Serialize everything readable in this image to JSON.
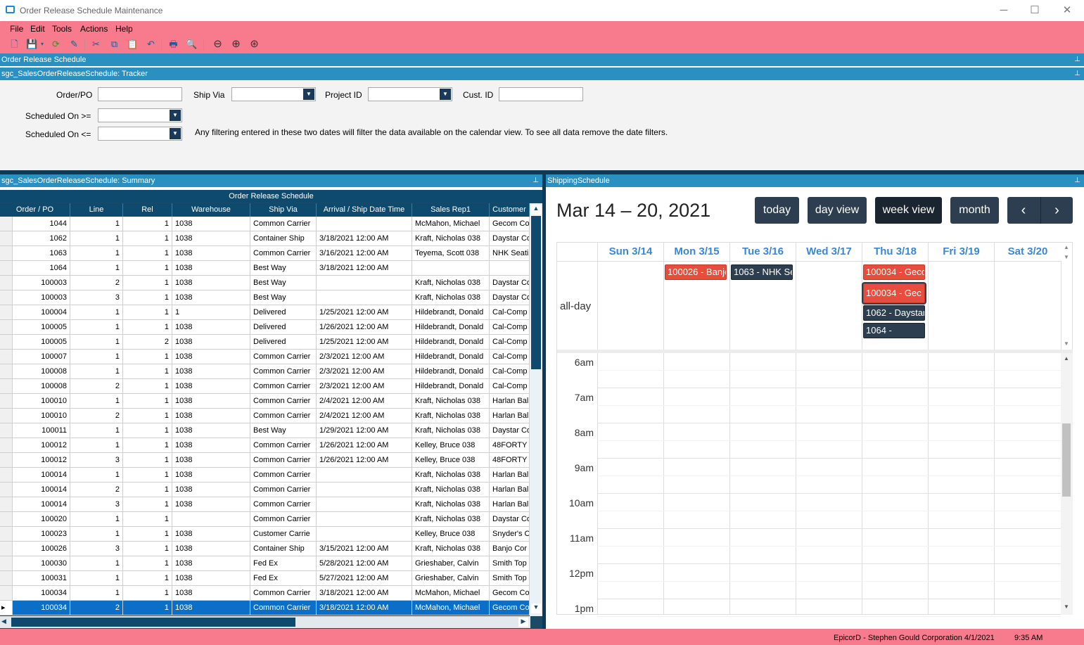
{
  "window": {
    "title": "Order Release Schedule Maintenance"
  },
  "menu": {
    "file": "File",
    "edit": "Edit",
    "tools": "Tools",
    "actions": "Actions",
    "help": "Help"
  },
  "panels": {
    "order_release": "Order Release Schedule",
    "tracker": "sgc_SalesOrderReleaseSchedule: Tracker",
    "summary": "sgc_SalesOrderReleaseSchedule: Summary",
    "shipping": "ShippingSchedule"
  },
  "tracker": {
    "order_po": "Order/PO",
    "ship_via": "Ship Via",
    "project_id": "Project ID",
    "cust_id": "Cust. ID",
    "sched_ge": "Scheduled On >=",
    "sched_le": "Scheduled On <=",
    "note": "Any filtering entered in these two dates will filter the data available on the calendar view. To see all data remove the date filters."
  },
  "grid": {
    "caption": "Order Release Schedule",
    "columns": [
      "Order / PO",
      "Line",
      "Rel",
      "Warehouse",
      "Ship Via",
      "Arrival / Ship Date Time",
      "Sales Rep1",
      "Customer"
    ],
    "rows": [
      [
        "1044",
        "1",
        "1",
        "1038",
        "Common Carrier",
        "",
        "McMahon, Michael",
        "Gecom Co"
      ],
      [
        "1062",
        "1",
        "1",
        "1038",
        "Container Ship",
        "3/18/2021 12:00 AM",
        "Kraft, Nicholas 038",
        "Daystar Co"
      ],
      [
        "1063",
        "1",
        "1",
        "1038",
        "Common Carrier",
        "3/16/2021 12:00 AM",
        "Teyema, Scott 038",
        "NHK Seati"
      ],
      [
        "1064",
        "1",
        "1",
        "1038",
        "Best Way",
        "3/18/2021 12:00 AM",
        "",
        ""
      ],
      [
        "100003",
        "2",
        "1",
        "1038",
        "Best Way",
        "",
        "Kraft, Nicholas 038",
        "Daystar Co"
      ],
      [
        "100003",
        "3",
        "1",
        "1038",
        "Best Way",
        "",
        "Kraft, Nicholas 038",
        "Daystar Co"
      ],
      [
        "100004",
        "1",
        "1",
        "1",
        "Delivered",
        "1/25/2021 12:00 AM",
        "Hildebrandt, Donald",
        "Cal-Comp"
      ],
      [
        "100005",
        "1",
        "1",
        "1038",
        "Delivered",
        "1/26/2021 12:00 AM",
        "Hildebrandt, Donald",
        "Cal-Comp"
      ],
      [
        "100005",
        "1",
        "2",
        "1038",
        "Delivered",
        "1/25/2021 12:00 AM",
        "Hildebrandt, Donald",
        "Cal-Comp"
      ],
      [
        "100007",
        "1",
        "1",
        "1038",
        "Common Carrier",
        "2/3/2021 12:00 AM",
        "Hildebrandt, Donald",
        "Cal-Comp"
      ],
      [
        "100008",
        "1",
        "1",
        "1038",
        "Common Carrier",
        "2/3/2021 12:00 AM",
        "Hildebrandt, Donald",
        "Cal-Comp"
      ],
      [
        "100008",
        "2",
        "1",
        "1038",
        "Common Carrier",
        "2/3/2021 12:00 AM",
        "Hildebrandt, Donald",
        "Cal-Comp"
      ],
      [
        "100010",
        "1",
        "1",
        "1038",
        "Common Carrier",
        "2/4/2021 12:00 AM",
        "Kraft, Nicholas 038",
        "Harlan Bal"
      ],
      [
        "100010",
        "2",
        "1",
        "1038",
        "Common Carrier",
        "2/4/2021 12:00 AM",
        "Kraft, Nicholas 038",
        "Harlan Bal"
      ],
      [
        "100011",
        "1",
        "1",
        "1038",
        "Best Way",
        "1/29/2021 12:00 AM",
        "Kraft, Nicholas 038",
        "Daystar Co"
      ],
      [
        "100012",
        "1",
        "1",
        "1038",
        "Common Carrier",
        "1/26/2021 12:00 AM",
        "Kelley, Bruce 038",
        "48FORTY"
      ],
      [
        "100012",
        "3",
        "1",
        "1038",
        "Common Carrier",
        "1/26/2021 12:00 AM",
        "Kelley, Bruce 038",
        "48FORTY"
      ],
      [
        "100014",
        "1",
        "1",
        "1038",
        "Common Carrier",
        "",
        "Kraft, Nicholas 038",
        "Harlan Bal"
      ],
      [
        "100014",
        "2",
        "1",
        "1038",
        "Common Carrier",
        "",
        "Kraft, Nicholas 038",
        "Harlan Bal"
      ],
      [
        "100014",
        "3",
        "1",
        "1038",
        "Common Carrier",
        "",
        "Kraft, Nicholas 038",
        "Harlan Bal"
      ],
      [
        "100020",
        "1",
        "1",
        "",
        "Common Carrier",
        "",
        "Kraft, Nicholas 038",
        "Daystar Co"
      ],
      [
        "100023",
        "1",
        "1",
        "1038",
        "Customer Carrie",
        "",
        "Kelley, Bruce 038",
        "Snyder's C"
      ],
      [
        "100026",
        "3",
        "1",
        "1038",
        "Container Ship",
        "3/15/2021 12:00 AM",
        "Kraft, Nicholas 038",
        "Banjo Cor"
      ],
      [
        "100030",
        "1",
        "1",
        "1038",
        "Fed Ex",
        "5/28/2021 12:00 AM",
        "Grieshaber, Calvin",
        "Smith Top"
      ],
      [
        "100031",
        "1",
        "1",
        "1038",
        "Fed Ex",
        "5/27/2021 12:00 AM",
        "Grieshaber, Calvin",
        "Smith Top"
      ],
      [
        "100034",
        "1",
        "1",
        "1038",
        "Common Carrier",
        "3/18/2021 12:00 AM",
        "McMahon, Michael",
        "Gecom Co"
      ],
      [
        "100034",
        "2",
        "1",
        "1038",
        "Common Carrier",
        "3/18/2021 12:00 AM",
        "McMahon, Michael",
        "Gecom Co"
      ]
    ]
  },
  "calendar": {
    "range_title": "Mar 14 – 20, 2021",
    "today": "today",
    "day_view": "day view",
    "week_view": "week view",
    "month": "month",
    "prev_icon": "chevron-left",
    "next_icon": "chevron-right",
    "days": [
      "Sun 3/14",
      "Mon 3/15",
      "Tue 3/16",
      "Wed 3/17",
      "Thu 3/18",
      "Fri 3/19",
      "Sat 3/20"
    ],
    "allday_label": "all-day",
    "events": [
      {
        "text": "100026 - Banjo",
        "day": 1,
        "slot": 0,
        "color": "#e74c3c"
      },
      {
        "text": "1063 - NHK Se",
        "day": 2,
        "slot": 0,
        "color": "#2c3e50"
      },
      {
        "text": "100034 - Geco",
        "day": 4,
        "slot": 0,
        "color": "#e74c3c"
      },
      {
        "text": "100034 - Gec",
        "day": 4,
        "slot": 1,
        "color": "#e74c3c"
      },
      {
        "text": "1062 - Daystar",
        "day": 4,
        "slot": 2,
        "color": "#2c3e50"
      },
      {
        "text": "1064 -",
        "day": 4,
        "slot": 3,
        "color": "#2c3e50"
      }
    ],
    "times": [
      "6am",
      "7am",
      "8am",
      "9am",
      "10am",
      "11am",
      "12pm",
      "1pm"
    ]
  },
  "status": {
    "company": "EpicorD - Stephen Gould Corporation 4/1/2021",
    "time": "9:35 AM"
  },
  "colors": {
    "brand_pink": "#f87b8d",
    "header_blue": "#2a8fc1",
    "grid_header": "#0e4a6e",
    "selected_row": "#0b6fc8",
    "cal_dark": "#2c3e50",
    "cal_red": "#e74c3c",
    "cal_link": "#3a87d6"
  }
}
